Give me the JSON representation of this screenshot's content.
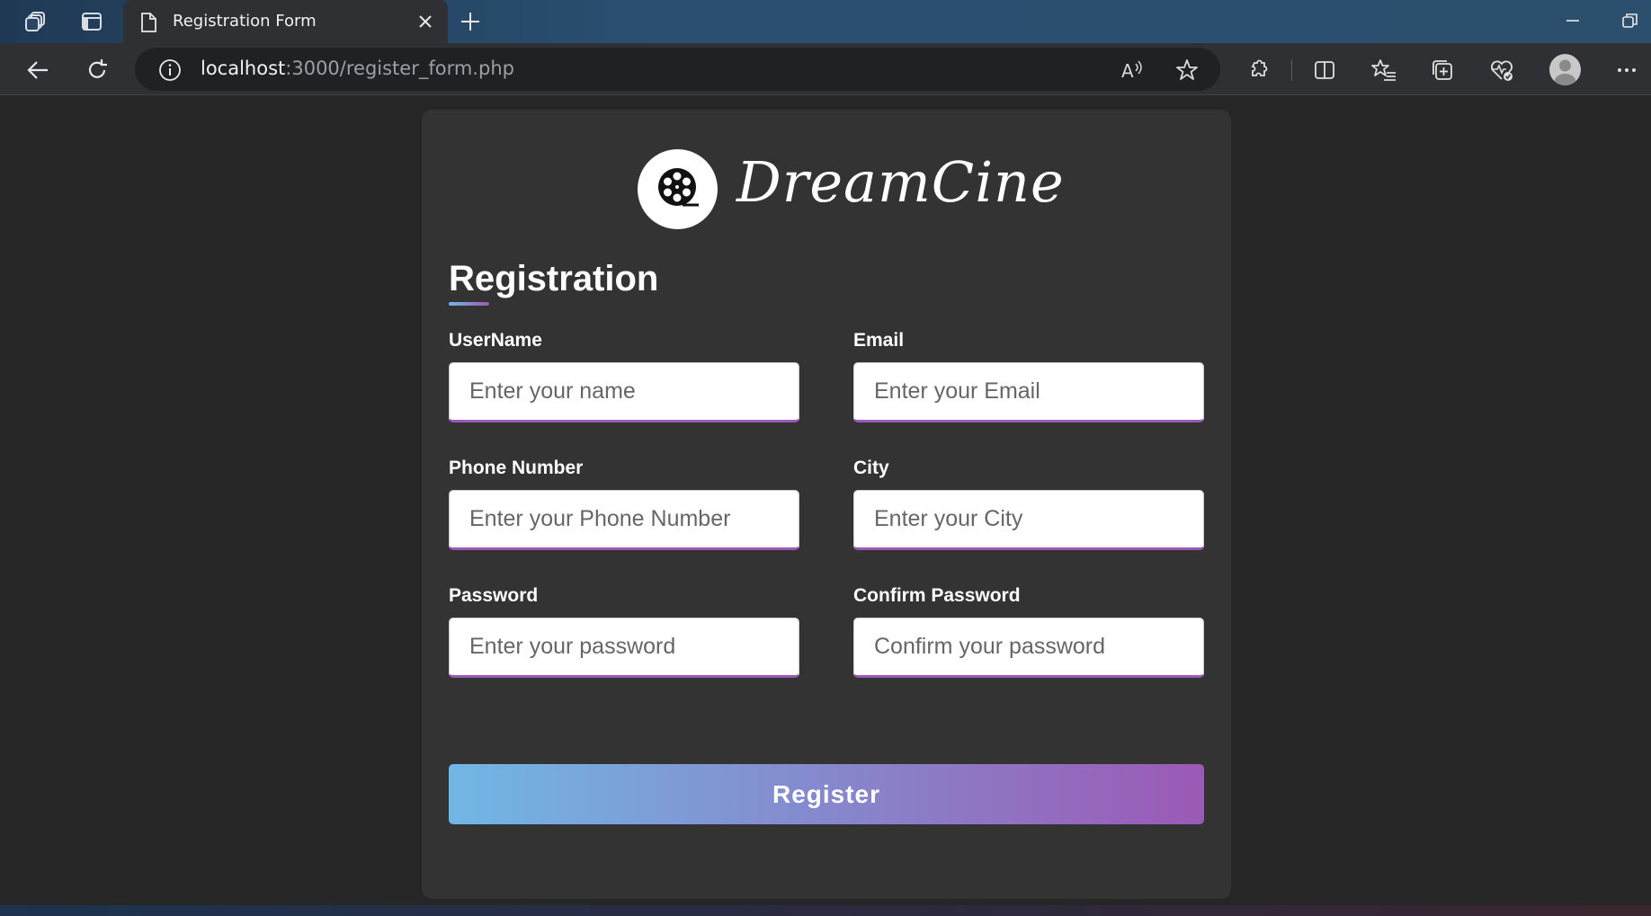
{
  "browser": {
    "tab_title": "Registration Form",
    "address_host": "localhost",
    "address_path": ":3000/register_form.php"
  },
  "icons": {
    "workspaces": "workspaces-icon",
    "tab_actions": "tab-actions-icon",
    "page": "page-icon",
    "close_tab": "close-icon",
    "new_tab": "plus-icon",
    "back": "back-arrow-icon",
    "refresh": "refresh-icon",
    "site_info": "info-icon",
    "read_aloud": "read-aloud-icon",
    "favorite": "star-icon",
    "extensions": "puzzle-icon",
    "split_screen": "split-screen-icon",
    "favorites": "favorites-list-icon",
    "collections": "collections-icon",
    "browser_essentials": "heart-pulse-icon",
    "profile": "profile-avatar",
    "more": "more-dots-icon",
    "logo": "film-reel-icon"
  },
  "page": {
    "brand": "DreamCine",
    "heading": "Registration",
    "fields": [
      {
        "label": "UserName",
        "placeholder": "Enter your name",
        "value": ""
      },
      {
        "label": "Email",
        "placeholder": "Enter your Email",
        "value": ""
      },
      {
        "label": "Phone Number",
        "placeholder": "Enter your Phone Number",
        "value": ""
      },
      {
        "label": "City",
        "placeholder": "Enter your City",
        "value": ""
      },
      {
        "label": "Password",
        "placeholder": "Enter your password",
        "value": ""
      },
      {
        "label": "Confirm Password",
        "placeholder": "Confirm your password",
        "value": ""
      }
    ],
    "submit_label": "Register"
  },
  "colors": {
    "page_bg": "#262626",
    "card_bg": "#333333",
    "gradient_start": "#71b7e6",
    "gradient_end": "#9b59b6"
  }
}
